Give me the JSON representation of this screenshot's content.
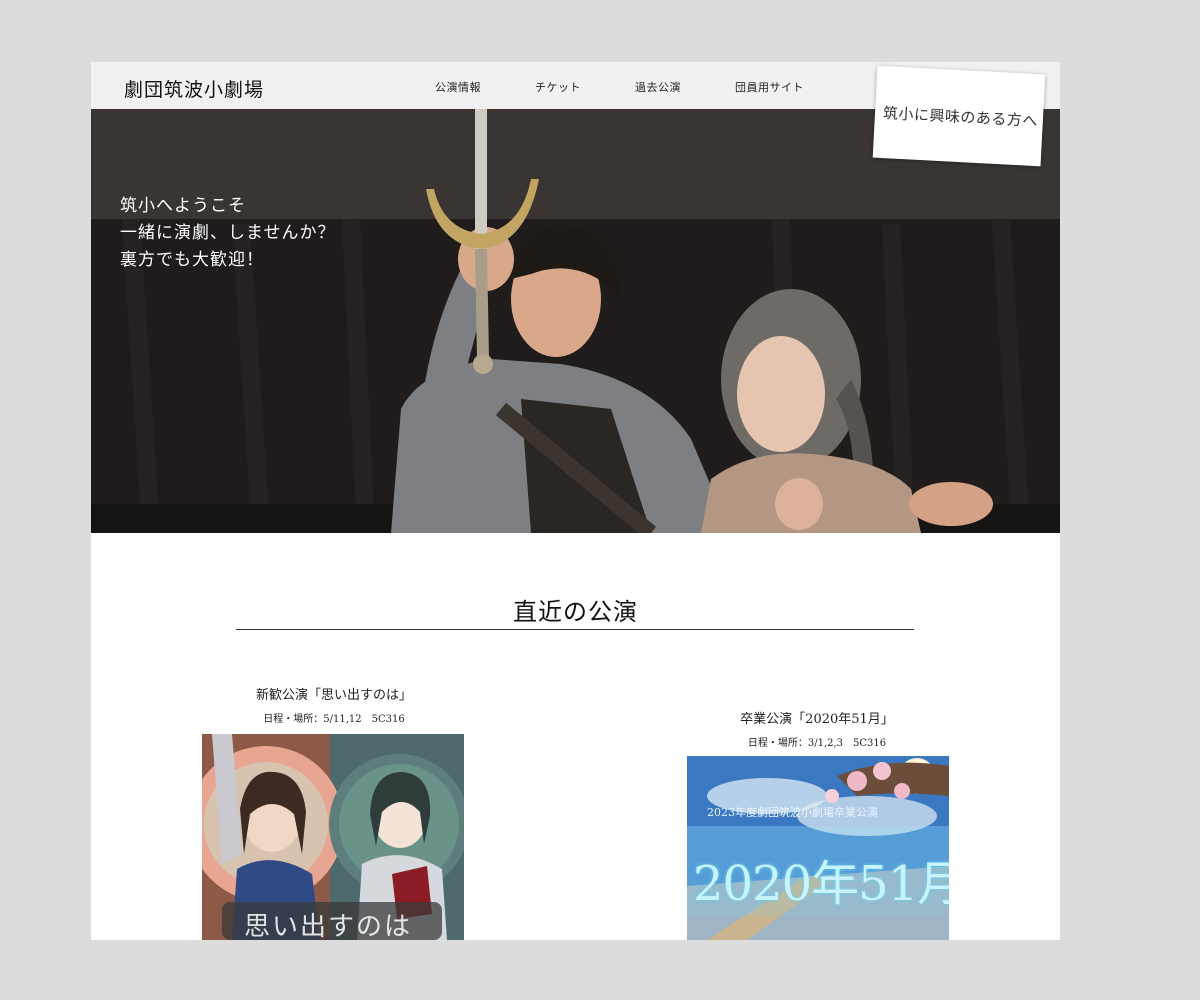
{
  "header": {
    "site_title": "劇団筑波小劇場",
    "nav": [
      {
        "label": "公演情報"
      },
      {
        "label": "チケット"
      },
      {
        "label": "過去公演"
      },
      {
        "label": "団員用サイト"
      }
    ]
  },
  "hero": {
    "lines": [
      "筑小へようこそ",
      "一緒に演劇、しませんか？",
      "裏方でも大歓迎！"
    ],
    "note_card": "筑小に興味のある方へ"
  },
  "section": {
    "title": "直近の公演"
  },
  "performances": [
    {
      "title": "新歓公演「思い出すのは」",
      "details": "日程・場所：5/11,12　5C316",
      "poster_text": "思い出すのは"
    },
    {
      "title": "卒業公演「2020年51月」",
      "details": "日程・場所：3/1,2,3　5C316",
      "poster_subtitle": "2023年度劇団筑波小劇場卒業公演",
      "poster_text": "2020年51月"
    }
  ],
  "colors": {
    "page_bg": "#dcdcdc",
    "header_bg": "#f1f1f1",
    "hero_text": "#ffffff",
    "rule": "#333333"
  }
}
